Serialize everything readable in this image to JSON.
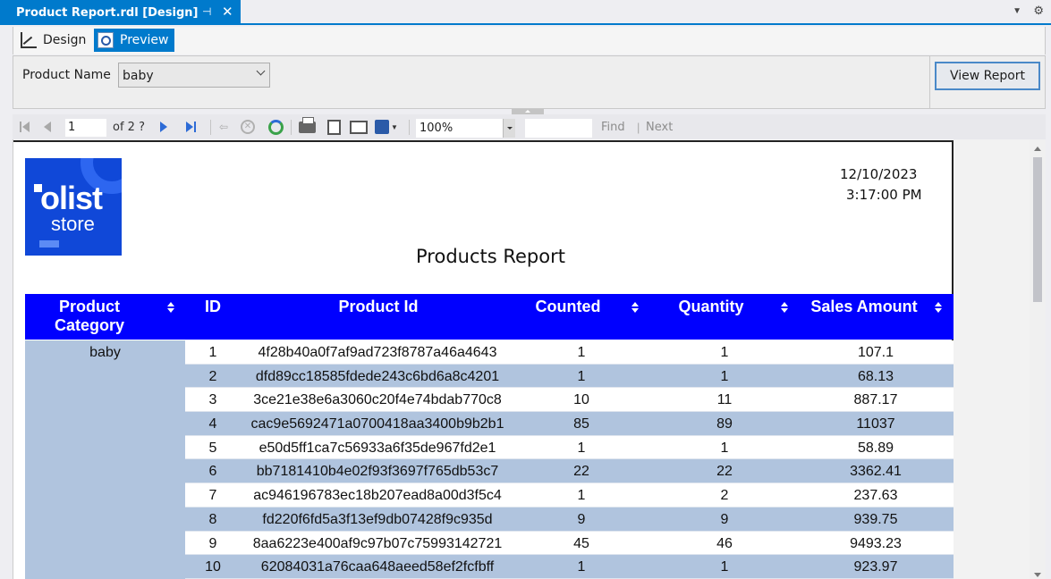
{
  "tab": {
    "title": "Product Report.rdl [Design]",
    "pin_glyph": "⊣",
    "close_glyph": "✕"
  },
  "modes": {
    "design": "Design",
    "preview": "Preview"
  },
  "parameters": {
    "label": "Product Name",
    "value": "baby",
    "view_button": "View Report"
  },
  "toolbar": {
    "page_number": "1",
    "page_of": "of  2 ?",
    "zoom": "100%",
    "find": "Find",
    "find_separator": "|",
    "next": "Next"
  },
  "report": {
    "logo_word1": "olist",
    "logo_word2": "store",
    "date": "12/10/2023",
    "time": "3:17:00 PM",
    "title": "Products Report",
    "columns": {
      "category": "Product Category",
      "id": "ID",
      "product_id": "Product Id",
      "counted": "Counted",
      "quantity": "Quantity",
      "sales": "Sales Amount"
    },
    "category_value": "baby",
    "rows": [
      {
        "id": "1",
        "product_id": "4f28b40a0f7af9ad723f8787a46a4643",
        "counted": "1",
        "quantity": "1",
        "sales": "107.1"
      },
      {
        "id": "2",
        "product_id": "dfd89cc18585fdede243c6bd6a8c4201",
        "counted": "1",
        "quantity": "1",
        "sales": "68.13"
      },
      {
        "id": "3",
        "product_id": "3ce21e38e6a3060c20f4e74bdab770c8",
        "counted": "10",
        "quantity": "11",
        "sales": "887.17"
      },
      {
        "id": "4",
        "product_id": "cac9e5692471a0700418aa3400b9b2b1",
        "counted": "85",
        "quantity": "89",
        "sales": "11037"
      },
      {
        "id": "5",
        "product_id": "e50d5ff1ca7c56933a6f35de967fd2e1",
        "counted": "1",
        "quantity": "1",
        "sales": "58.89"
      },
      {
        "id": "6",
        "product_id": "bb7181410b4e02f93f3697f765db53c7",
        "counted": "22",
        "quantity": "22",
        "sales": "3362.41"
      },
      {
        "id": "7",
        "product_id": "ac946196783ec18b207ead8a00d3f5c4",
        "counted": "1",
        "quantity": "2",
        "sales": "237.63"
      },
      {
        "id": "8",
        "product_id": "fd220f6fd5a3f13ef9db07428f9c935d",
        "counted": "9",
        "quantity": "9",
        "sales": "939.75"
      },
      {
        "id": "9",
        "product_id": "8aa6223e400af9c97b07c75993142721",
        "counted": "45",
        "quantity": "46",
        "sales": "9493.23"
      },
      {
        "id": "10",
        "product_id": "62084031a76caa648aeed58ef2fcfbff",
        "counted": "1",
        "quantity": "1",
        "sales": "923.97"
      }
    ]
  },
  "colors": {
    "accent": "#007acc",
    "header_blue": "#0000ff",
    "row_alt": "#b0c4de",
    "logo_blue": "#1048d8"
  }
}
